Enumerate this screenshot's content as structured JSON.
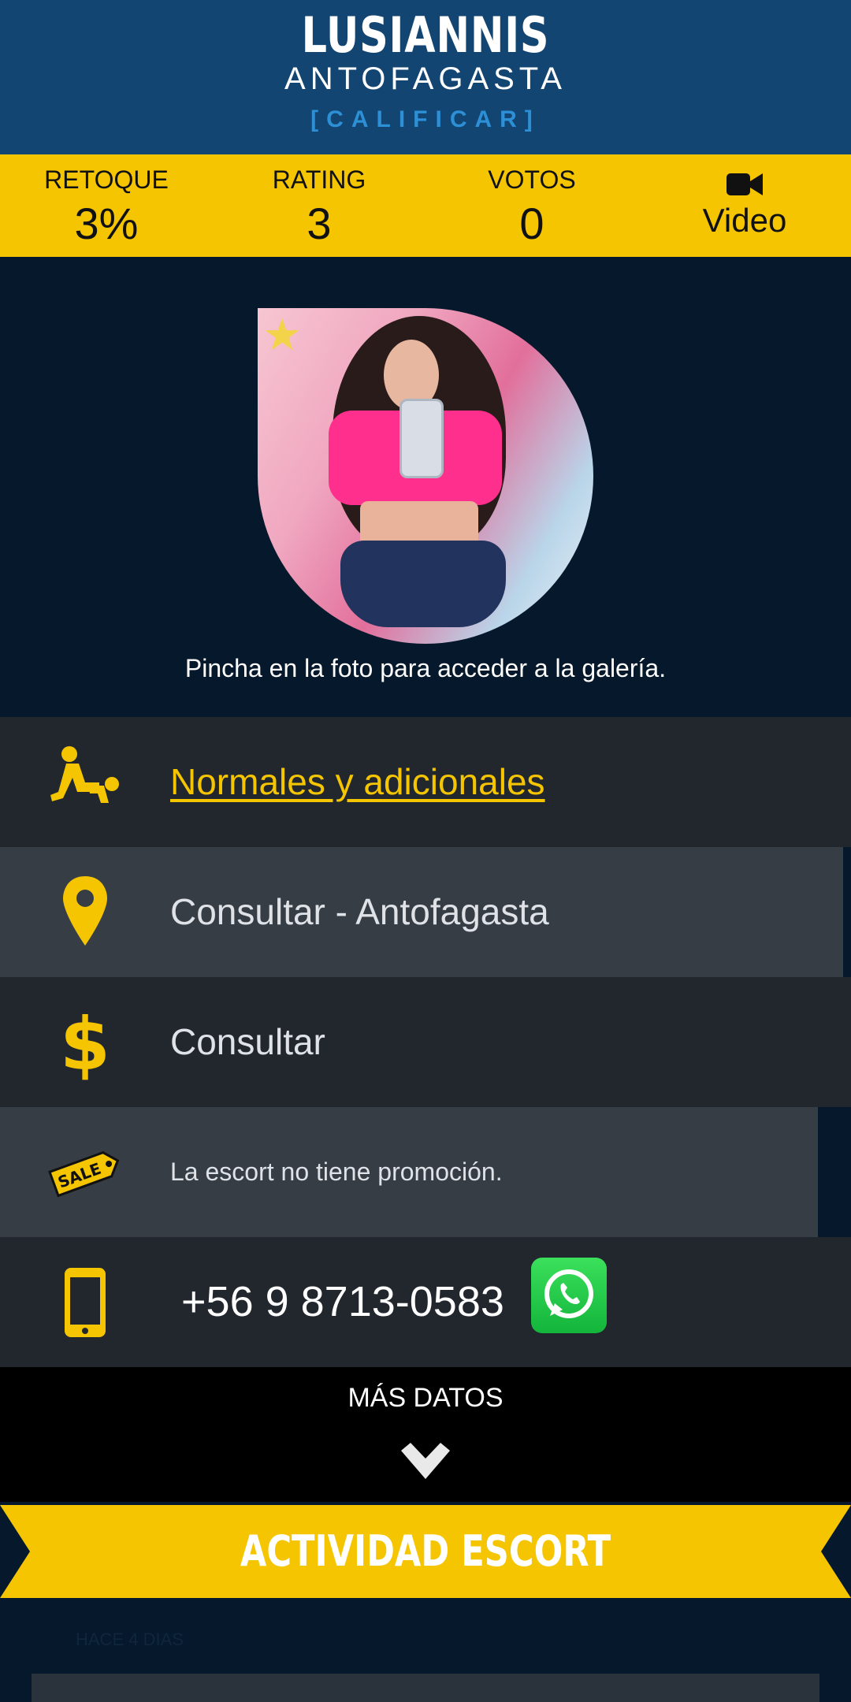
{
  "header": {
    "name": "LUSIANNIS",
    "city": "ANTOFAGASTA",
    "rate_link": "[CALIFICAR]"
  },
  "stats": {
    "retoque_label": "RETOQUE",
    "retoque_value": "3%",
    "rating_label": "RATING",
    "rating_value": "3",
    "votos_label": "VOTOS",
    "votos_value": "0",
    "video_label": "Video",
    "video_icon": "video-camera-icon"
  },
  "photo": {
    "caption": "Pincha en la foto para acceder a la galería."
  },
  "details": {
    "services": "Normales y adicionales",
    "location": "Consultar - Antofagasta",
    "price": "Consultar",
    "promotion": "La escort no tiene promoción.",
    "phone": "+56 9 8713-0583"
  },
  "more": {
    "label": "MÁS DATOS"
  },
  "banner": {
    "label": "ACTIVIDAD ESCORT"
  },
  "activity": {
    "time": "HACE 4 DIAS"
  },
  "colors": {
    "header_bg": "#124571",
    "accent_yellow": "#f4c500",
    "dark_bg": "#06182b",
    "row_bg": "#22272e",
    "row_alt_bg": "#363d45",
    "link_blue": "#2d8fd6"
  }
}
